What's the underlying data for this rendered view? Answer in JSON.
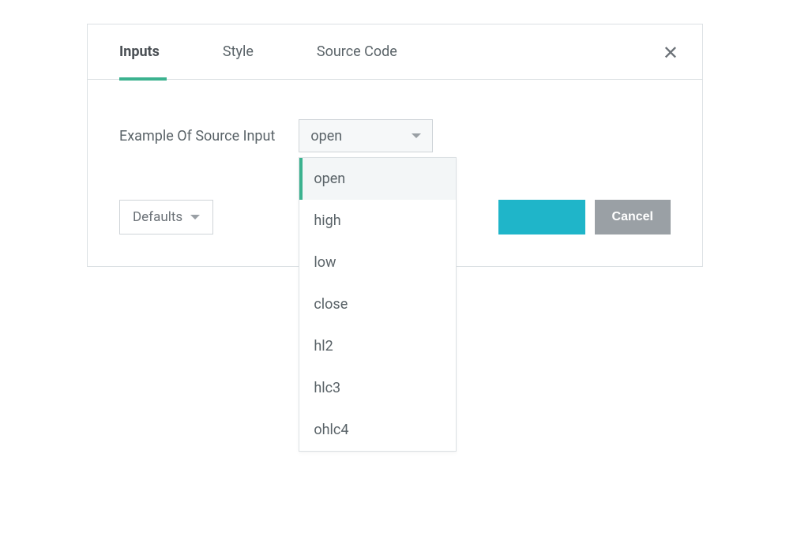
{
  "tabs": {
    "inputs": "Inputs",
    "style": "Style",
    "source_code": "Source Code"
  },
  "inputs": {
    "label": "Example Of Source Input",
    "selected": "open",
    "options": [
      "open",
      "high",
      "low",
      "close",
      "hl2",
      "hlc3",
      "ohlc4"
    ]
  },
  "footer": {
    "defaults": "Defaults",
    "cancel": "Cancel"
  }
}
